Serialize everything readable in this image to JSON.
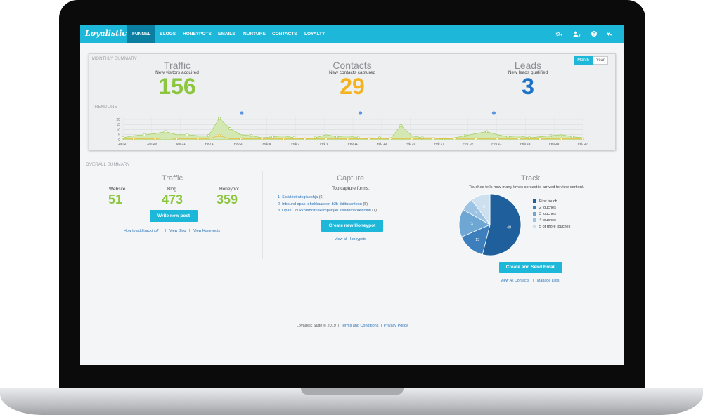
{
  "nav": {
    "logo": "Loyalistic",
    "items": [
      "FUNNEL",
      "BLOGS",
      "HONEYPOTS",
      "EMAILS",
      "NURTURE",
      "CONTACTS",
      "LOYALTY"
    ],
    "active": "FUNNEL",
    "icons": [
      "gear-icon",
      "user-icon",
      "help-icon",
      "heart-icon"
    ]
  },
  "monthly": {
    "title": "MONTHLY SUMMARY",
    "toggle": [
      "Month",
      "Year"
    ],
    "toggle_selected": "Month",
    "traffic": {
      "title": "Traffic",
      "sub": "New visitors acquired",
      "value": "156",
      "color": "#8cc63f"
    },
    "contacts": {
      "title": "Contacts",
      "sub": "New contacts captured",
      "value": "29",
      "color": "#f4b21e"
    },
    "leads": {
      "title": "Leads",
      "sub": "New leads qualified",
      "value": "3",
      "color": "#1e73c9"
    },
    "trendline_label": "TRENDLINE"
  },
  "chart_data": {
    "type": "area",
    "y_ticks": [
      "20",
      "15",
      "10",
      "5",
      "0"
    ],
    "ylim": [
      0,
      22
    ],
    "x_labels": [
      "Jan 27",
      "Jan 29",
      "Jan 31",
      "Feb 1",
      "Feb 3",
      "Feb 5",
      "Feb 7",
      "Feb 9",
      "Feb 11",
      "Feb 13",
      "Feb 15",
      "Feb 17",
      "Feb 19",
      "Feb 21",
      "Feb 23",
      "Feb 25",
      "Feb 27"
    ],
    "series": [
      {
        "values": [
          2,
          4,
          5,
          6,
          8,
          5,
          5,
          4,
          4,
          21,
          11,
          5,
          4,
          2,
          3,
          4,
          2,
          1,
          2,
          5,
          3,
          4,
          2,
          1,
          2,
          1,
          14,
          4,
          2,
          2,
          1,
          2,
          4,
          6,
          8,
          5,
          3,
          4,
          2,
          3,
          4,
          5,
          3,
          2
        ]
      },
      {
        "values": [
          1,
          1,
          1,
          1,
          2,
          1,
          1,
          1,
          1,
          4,
          1,
          1,
          1,
          1,
          1,
          1,
          1,
          1,
          1,
          1,
          1,
          1,
          1,
          1,
          1,
          1,
          1,
          1,
          1,
          1,
          1,
          1,
          1,
          1,
          1,
          1,
          1,
          1,
          1,
          1,
          1,
          1,
          1,
          1
        ]
      }
    ],
    "leads_markers": [
      "Feb 4",
      "Feb 12",
      "Feb 21"
    ],
    "colors": {
      "traffic": "#8cc63f",
      "contacts": "#f4b21e",
      "leads": "#5b95e0"
    }
  },
  "overall": {
    "title": "OVERALL SUMMARY",
    "traffic": {
      "title": "Traffic",
      "labels": [
        "Website",
        "Blog",
        "Honeypot"
      ],
      "values": [
        "51",
        "473",
        "359"
      ],
      "button": "Write new post",
      "links": [
        "How to add tracking?",
        "View Blog",
        "View Honeypots"
      ]
    },
    "capture": {
      "title": "Capture",
      "sub": "Top capture forms:",
      "forms": [
        {
          "n": "1.",
          "name": "Sisältöstrategiapohja",
          "count": "(6)"
        },
        {
          "n": "2.",
          "name": "Inbound opas tehokkaaseen b2b-liiditucantoon",
          "count": "(5)"
        },
        {
          "n": "3.",
          "name": "Opas: Joukkorahoituskampanjan sisältömarkkinointi",
          "count": "(1)"
        }
      ],
      "button": "Create new Honeypot",
      "link": "View all Honeypots"
    },
    "track": {
      "title": "Track",
      "sub": "Touches tells how many times contact is arrived to view content.",
      "pie": [
        {
          "label": "First touch",
          "value": 48,
          "color": "#1f5f9c"
        },
        {
          "label": "2 touches",
          "value": 13,
          "color": "#3c7fbc"
        },
        {
          "label": "3 touches",
          "value": 13,
          "color": "#6ea6d4"
        },
        {
          "label": "4 touches",
          "value": 6,
          "color": "#9cc3e4"
        },
        {
          "label": "5 or more touches",
          "value": 9,
          "color": "#cde0f0"
        }
      ],
      "button": "Create and Send Email",
      "links": [
        "View All Contacts",
        "Manage Lists"
      ]
    }
  },
  "footer": {
    "copyright": "Loyalistic Suite © 2019",
    "links": [
      "Terms and Conditions",
      "Privacy Policy"
    ],
    "sep": "|"
  }
}
